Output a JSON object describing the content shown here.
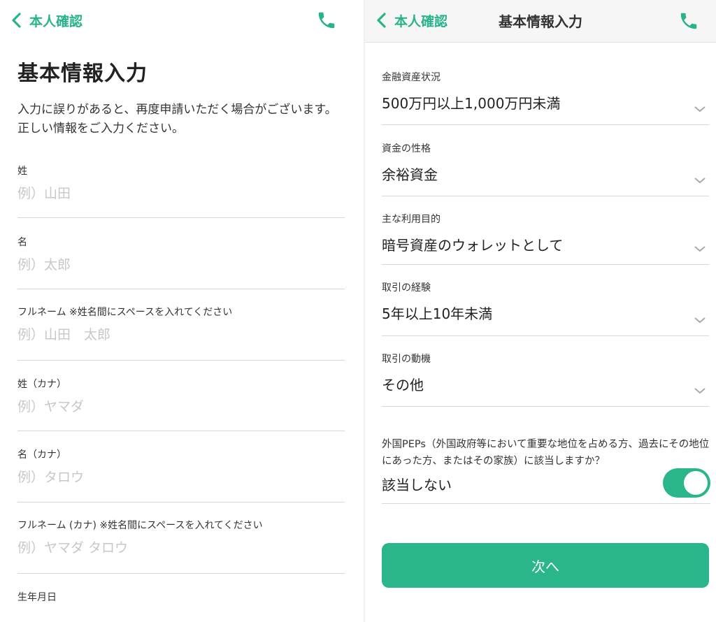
{
  "left_screen": {
    "nav": {
      "back_label": "本人確認"
    },
    "heading": "基本情報入力",
    "lead": "入力に誤りがあると、再度申請いただく場合がございます。正しい情報をご入力ください。",
    "fields": [
      {
        "label": "姓",
        "placeholder": "例）山田"
      },
      {
        "label": "名",
        "placeholder": "例）太郎"
      },
      {
        "label": "フルネーム",
        "note": "※姓名間にスペースを入れてください",
        "placeholder": "例）山田　太郎"
      },
      {
        "label": "姓（カナ）",
        "placeholder": "例）ヤマダ"
      },
      {
        "label": "名（カナ）",
        "placeholder": "例）タロウ"
      },
      {
        "label": "フルネーム (カナ)",
        "note": "※姓名間にスペースを入れてください",
        "placeholder": "例）ヤマダ タロウ"
      },
      {
        "label": "生年月日"
      }
    ]
  },
  "right_screen": {
    "nav": {
      "back_label": "本人確認",
      "title": "基本情報入力"
    },
    "selects": [
      {
        "label": "金融資産状況",
        "value": "500万円以上1,000万円未満"
      },
      {
        "label": "資金の性格",
        "value": "余裕資金"
      },
      {
        "label": "主な利用目的",
        "value": "暗号資産のウォレットとして"
      },
      {
        "label": "取引の経験",
        "value": "5年以上10年未満"
      },
      {
        "label": "取引の動機",
        "value": "その他"
      }
    ],
    "peps": {
      "question": "外国PEPs（外国政府等において重要な地位を占める方、過去にその地位にあった方、またはその家族）に該当しますか？",
      "answer": "該当しない",
      "toggle_on": true
    },
    "next_button": "次へ"
  },
  "colors": {
    "accent": "#2bb58b",
    "divider": "#d6d6d6",
    "placeholder": "#c7c7c7"
  },
  "icons": {
    "back": "chevron-left-icon",
    "phone": "phone-icon",
    "select": "chevron-down-icon"
  }
}
